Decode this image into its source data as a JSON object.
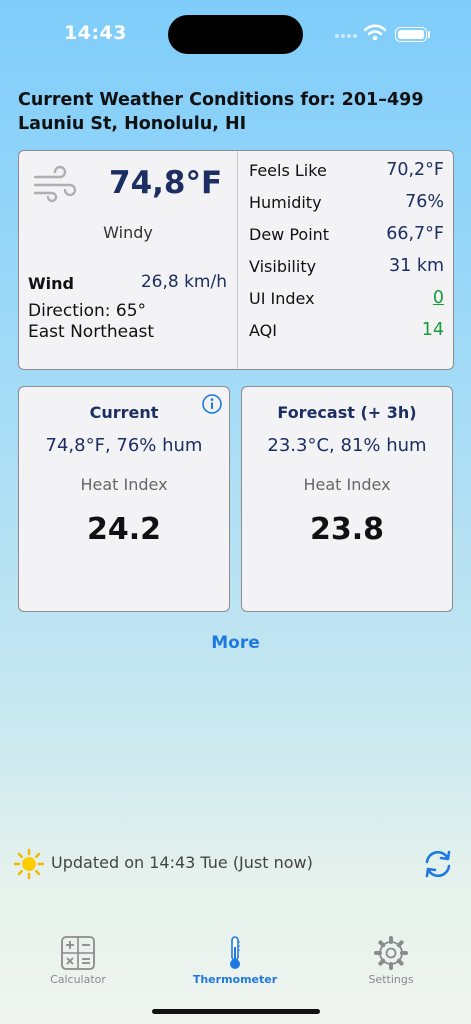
{
  "status": {
    "time": "14:43"
  },
  "heading": "Current Weather Conditions for: 201–499 Launiu St, Honolulu, HI",
  "current": {
    "temperature": "74,8°F",
    "condition": "Windy",
    "wind_label": "Wind",
    "wind_speed": "26,8 km/h",
    "direction": "Direction: 65°",
    "direction_name": "East Northeast",
    "icon": "wind-icon"
  },
  "metrics": [
    {
      "label": "Feels Like",
      "value": "70,2°F"
    },
    {
      "label": "Humidity",
      "value": "76%"
    },
    {
      "label": "Dew Point",
      "value": "66,7°F"
    },
    {
      "label": "Visibility",
      "value": "31 km"
    },
    {
      "label": "UI Index",
      "value": "0"
    },
    {
      "label": "AQI",
      "value": "14"
    }
  ],
  "heat_current": {
    "title": "Current",
    "reading": "74,8°F, 76% hum",
    "label": "Heat Index",
    "value": "24.2"
  },
  "heat_forecast": {
    "title": "Forecast (+ 3h)",
    "reading": "23.3°C, 81% hum",
    "label": "Heat Index",
    "value": "23.8"
  },
  "more_label": "More",
  "updated": "Updated on 14:43 Tue (Just now)",
  "tabs": [
    {
      "label": "Calculator",
      "icon": "calculator-icon"
    },
    {
      "label": "Thermometer",
      "icon": "thermometer-icon"
    },
    {
      "label": "Settings",
      "icon": "gear-icon"
    }
  ],
  "colors": {
    "accent": "#1f7ae0",
    "value_navy": "#1d2f62",
    "good_green": "#1a9b3a"
  }
}
